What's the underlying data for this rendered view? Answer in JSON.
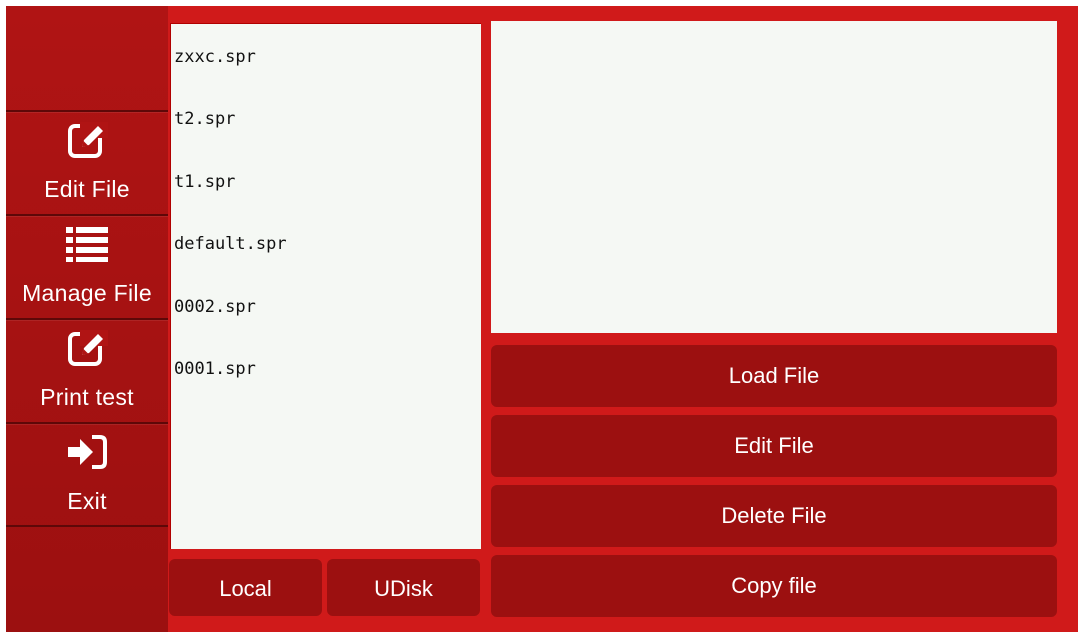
{
  "sidebar": {
    "items": [
      {
        "label": "Edit  File",
        "icon": "edit-icon"
      },
      {
        "label": "Manage  File",
        "icon": "list-icon"
      },
      {
        "label": "Print  test",
        "icon": "edit-icon"
      },
      {
        "label": "Exit",
        "icon": "sign-in-icon"
      }
    ]
  },
  "files": [
    "zxxc.spr",
    "t2.spr",
    "t1.spr",
    "default.spr",
    "0002.spr",
    "0001.spr"
  ],
  "actions": {
    "load": "Load  File",
    "edit": "Edit  File",
    "delete": "Delete  File",
    "copy": "Copy  file"
  },
  "storage": {
    "local": "Local",
    "udisk": "UDisk"
  },
  "colors": {
    "frame": "#d01a1a",
    "button": "#9c1010",
    "panel": "#f5f8f4"
  }
}
